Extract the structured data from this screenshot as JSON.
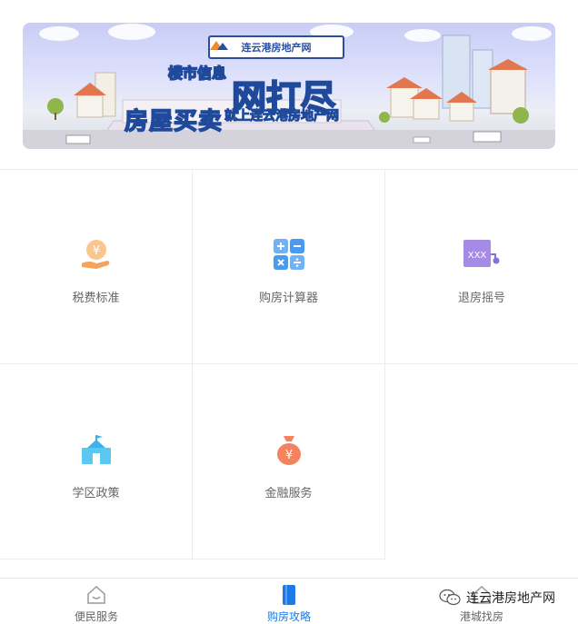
{
  "banner": {
    "brand": "连云港房地产网",
    "title_line1": "楼市信息",
    "title_big": "网打尽",
    "title_line2": "房屋买卖",
    "title_line3": "就上连云港房地产网"
  },
  "services": [
    {
      "label": "税费标准",
      "icon": "tax-coin-hand-icon"
    },
    {
      "label": "购房计算器",
      "icon": "calculator-icon"
    },
    {
      "label": "退房摇号",
      "icon": "lottery-xxx-icon"
    },
    {
      "label": "学区政策",
      "icon": "school-building-icon"
    },
    {
      "label": "金融服务",
      "icon": "money-bag-icon"
    }
  ],
  "nav": {
    "items": [
      {
        "label": "便民服务",
        "icon": "house-smile-icon"
      },
      {
        "label": "购房攻略",
        "icon": "guide-book-icon",
        "active": true
      },
      {
        "label": "港城找房",
        "icon": "house-search-icon"
      }
    ]
  },
  "watermark": {
    "text": "连云港房地产网",
    "icon": "wechat-icon"
  },
  "colors": {
    "active": "#1c7ae8",
    "text": "#666666",
    "orange": "#f5a25d",
    "blue": "#4a9bf0",
    "purple": "#9b7fe0",
    "teal": "#3bb5e8"
  }
}
